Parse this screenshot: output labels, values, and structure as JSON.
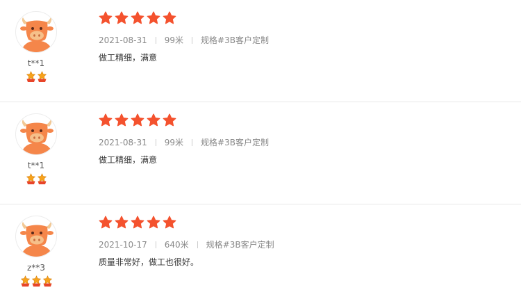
{
  "colors": {
    "rating_star": "#f4522e",
    "level_star": "#f7a21b",
    "level_base": "#e8452a",
    "avatar_face": "#f5864a",
    "divider": "#e8e8e8"
  },
  "icons": {
    "avatar": "ox-mascot-avatar",
    "rating": "star-icon",
    "level": "level-medal-icon"
  },
  "reviews": [
    {
      "username": "t**1",
      "level": 2,
      "rating": 5,
      "date": "2021-08-31",
      "length": "99米",
      "spec": "规格#3B客户定制",
      "text": "做工精细，满意"
    },
    {
      "username": "t**1",
      "level": 2,
      "rating": 5,
      "date": "2021-08-31",
      "length": "99米",
      "spec": "规格#3B客户定制",
      "text": "做工精细，满意"
    },
    {
      "username": "z**3",
      "level": 3,
      "rating": 5,
      "date": "2021-10-17",
      "length": "640米",
      "spec": "规格#3B客户定制",
      "text": "质量非常好，做工也很好。"
    }
  ]
}
